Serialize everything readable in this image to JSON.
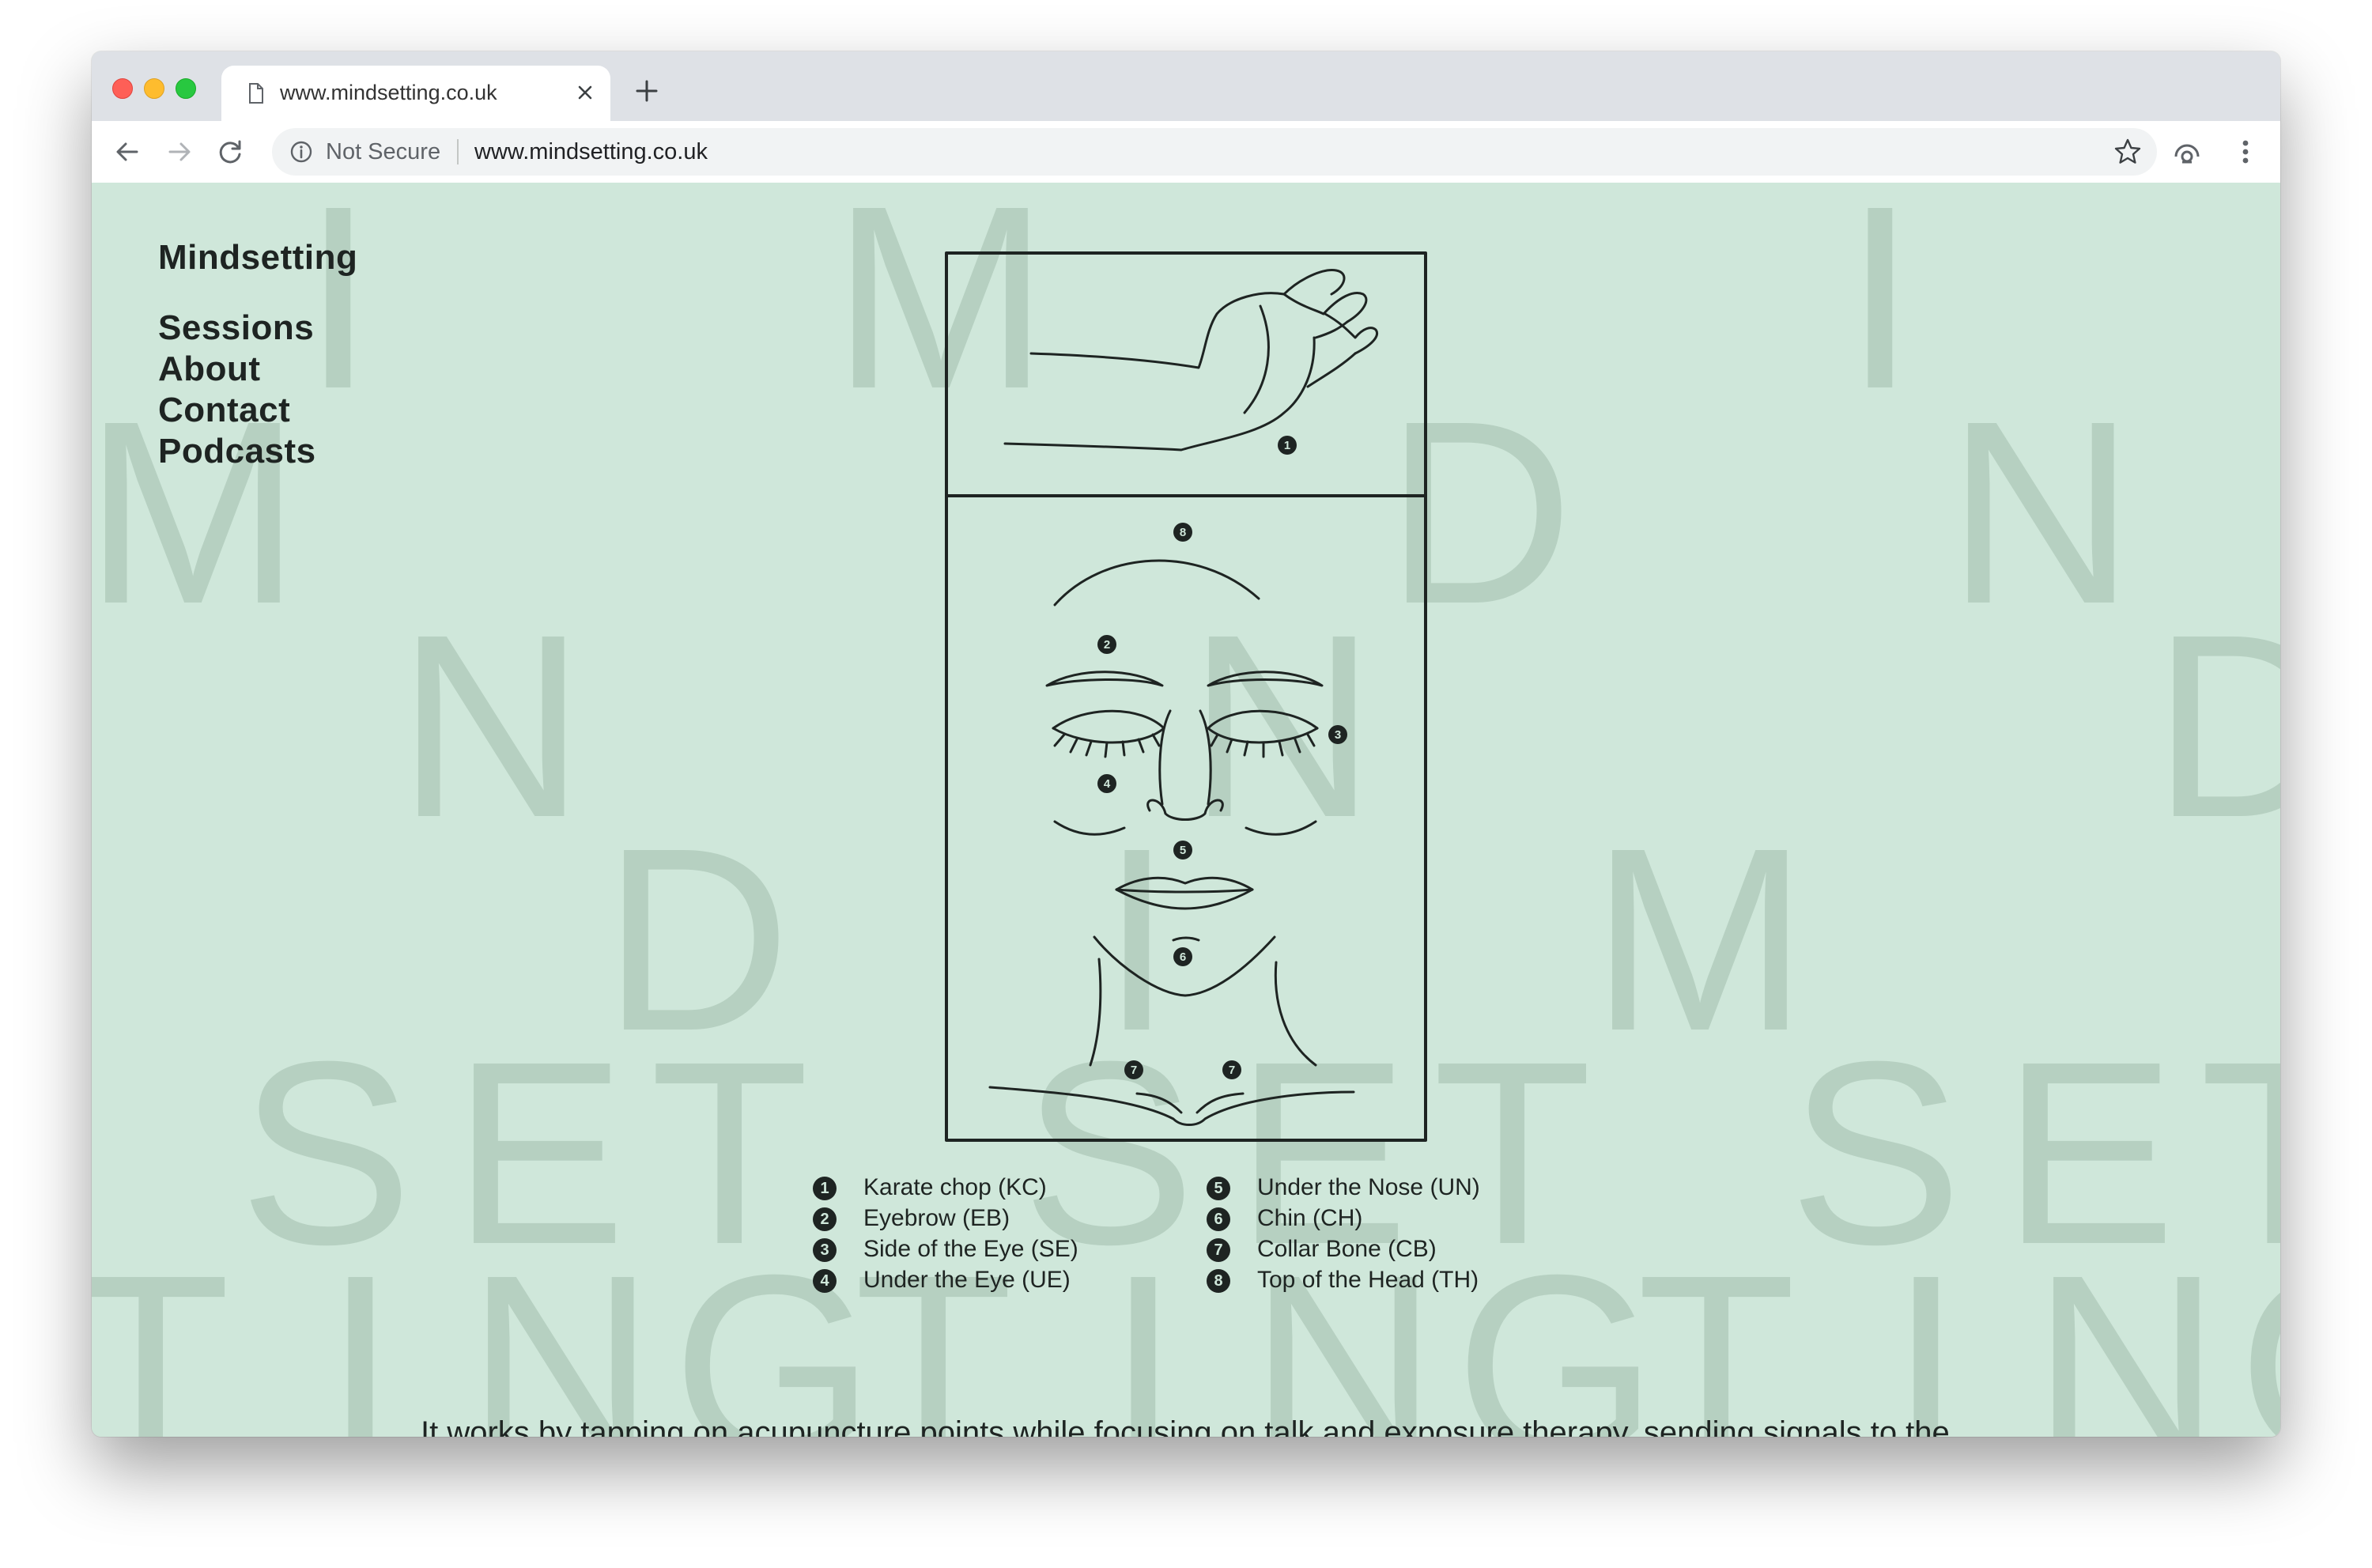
{
  "browser": {
    "tab_title": "www.mindsetting.co.uk",
    "security_label": "Not Secure",
    "url": "www.mindsetting.co.uk",
    "icons": [
      "document-icon",
      "close-icon",
      "plus-icon",
      "back-arrow-icon",
      "forward-arrow-icon",
      "reload-icon",
      "info-icon",
      "star-icon",
      "extension-icon",
      "menu-dots-icon"
    ]
  },
  "background_word": {
    "color": "#b6d0c1",
    "letters": [
      "M",
      "I",
      "N",
      "D",
      "S",
      "E",
      "T",
      "T",
      "I",
      "N",
      "G"
    ]
  },
  "nav": {
    "brand": "Mindsetting",
    "items": [
      "Sessions",
      "About",
      "Contact",
      "Podcasts"
    ]
  },
  "tapping_points": {
    "points": [
      {
        "num": "1",
        "label": "Karate chop (KC)"
      },
      {
        "num": "2",
        "label": "Eyebrow (EB)"
      },
      {
        "num": "3",
        "label": "Side of the Eye (SE)"
      },
      {
        "num": "4",
        "label": "Under the Eye (UE)"
      },
      {
        "num": "5",
        "label": "Under the Nose (UN)"
      },
      {
        "num": "6",
        "label": "Chin (CH)"
      },
      {
        "num": "7",
        "label": "Collar Bone (CB)"
      },
      {
        "num": "8",
        "label": "Top of the Head (TH)"
      }
    ]
  },
  "body": {
    "paragraph": "It works by tapping on acupuncture points while focusing on talk and exposure therapy, sending signals to the brain to shut down the immediate stressful response. Just like a"
  },
  "colors": {
    "page_background": "#cfe7da",
    "text": "#1e2422"
  }
}
